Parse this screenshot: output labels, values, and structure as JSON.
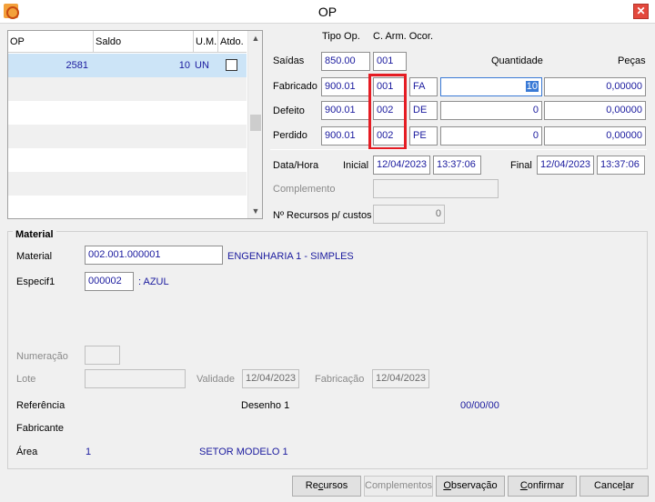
{
  "window": {
    "title": "OP",
    "close_glyph": "✕",
    "app_icon": "app-icon"
  },
  "grid": {
    "headers": [
      "OP",
      "Saldo",
      "U.M.",
      "Atdo."
    ],
    "rows": [
      {
        "op": "2581",
        "saldo": "10",
        "um": "UN",
        "atdo": false
      }
    ]
  },
  "header_labels": {
    "tipo_op": "Tipo Op.",
    "c_arm_ocor": "C. Arm. Ocor.",
    "quantidade": "Quantidade",
    "pecas": "Peças"
  },
  "saidas": {
    "label": "Saídas",
    "tipo": "850.00",
    "arm": "001"
  },
  "fabricado": {
    "label": "Fabricado",
    "tipo": "900.01",
    "arm": "001",
    "ocor": "FA",
    "quantidade": "10",
    "pecas": "0,00000"
  },
  "defeito": {
    "label": "Defeito",
    "tipo": "900.01",
    "arm": "002",
    "ocor": "DE",
    "quantidade": "0",
    "pecas": "0,00000"
  },
  "perdido": {
    "label": "Perdido",
    "tipo": "900.01",
    "arm": "002",
    "ocor": "PE",
    "quantidade": "0",
    "pecas": "0,00000"
  },
  "datahora": {
    "label": "Data/Hora",
    "inicial_label": "Inicial",
    "inicial_date": "12/04/2023",
    "inicial_time": "13:37:06",
    "final_label": "Final",
    "final_date": "12/04/2023",
    "final_time": "13:37:06"
  },
  "complemento": {
    "label": "Complemento",
    "value": ""
  },
  "recursos": {
    "label": "Nº Recursos p/ custos",
    "value": "0"
  },
  "material": {
    "group_title": "Material",
    "material_label": "Material",
    "material_code": "002.001.000001",
    "material_desc": "ENGENHARIA 1 - SIMPLES",
    "especif_label": "Especif1",
    "especif_code": "000002",
    "especif_desc": ": AZUL",
    "numeracao_label": "Numeração",
    "numeracao_value": "",
    "lote_label": "Lote",
    "lote_value": "",
    "validade_label": "Validade",
    "validade_value": "12/04/2023",
    "fabricacao_label": "Fabricação",
    "fabricacao_value": "12/04/2023",
    "referencia_label": "Referência",
    "desenho_label": "Desenho 1",
    "desenho_date": "00/00/00",
    "fabricante_label": "Fabricante",
    "area_label": "Área",
    "area_code": "1",
    "area_desc": "SETOR MODELO 1"
  },
  "buttons": {
    "recursos": {
      "pre": "Re",
      "u": "c",
      "post": "ursos"
    },
    "complementos": {
      "label": "Complementos"
    },
    "observacao": {
      "pre": "",
      "u": "O",
      "post": "bservação"
    },
    "confirmar": {
      "pre": "",
      "u": "C",
      "post": "onfirmar"
    },
    "cancelar": {
      "pre": "Cance",
      "u": "l",
      "post": "ar"
    }
  }
}
